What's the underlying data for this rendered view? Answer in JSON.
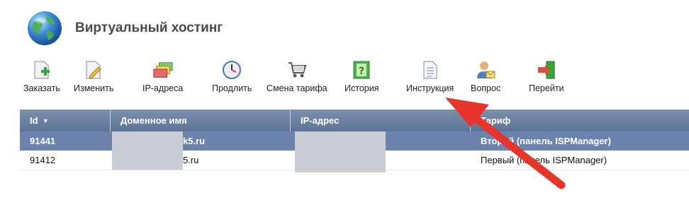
{
  "header": {
    "title": "Виртуальный хостинг",
    "logo_icon": "globe-icon"
  },
  "toolbar": {
    "items": [
      {
        "label": "Заказать",
        "icon": "add-page-icon"
      },
      {
        "label": "Изменить",
        "icon": "edit-page-icon"
      },
      {
        "label": "IP-адреса",
        "icon": "ip-cards-icon"
      },
      {
        "label": "Продлить",
        "icon": "clock-icon"
      },
      {
        "label": "Смена тарифа",
        "icon": "cart-icon"
      },
      {
        "label": "История",
        "icon": "help-book-icon"
      },
      {
        "label": "Инструкция",
        "icon": "document-icon"
      },
      {
        "label": "Вопрос",
        "icon": "user-mail-icon"
      },
      {
        "label": "Перейти",
        "icon": "goto-door-icon"
      }
    ]
  },
  "table": {
    "columns": [
      "Id",
      "Доменное имя",
      "IP-адрес",
      "Тариф"
    ],
    "rows": [
      {
        "id": "91441",
        "domain": "k5.ru",
        "ip": "",
        "tariff": "Второй (панель ISPManager)",
        "selected": true
      },
      {
        "id": "91412",
        "domain": "5.ru",
        "ip": "",
        "tariff": "Первый (панель ISPManager)",
        "selected": false
      }
    ]
  },
  "colors": {
    "header_bg": "#6b83ad",
    "selected_row": "#6b83ad",
    "annotation_arrow": "#e8342b"
  }
}
